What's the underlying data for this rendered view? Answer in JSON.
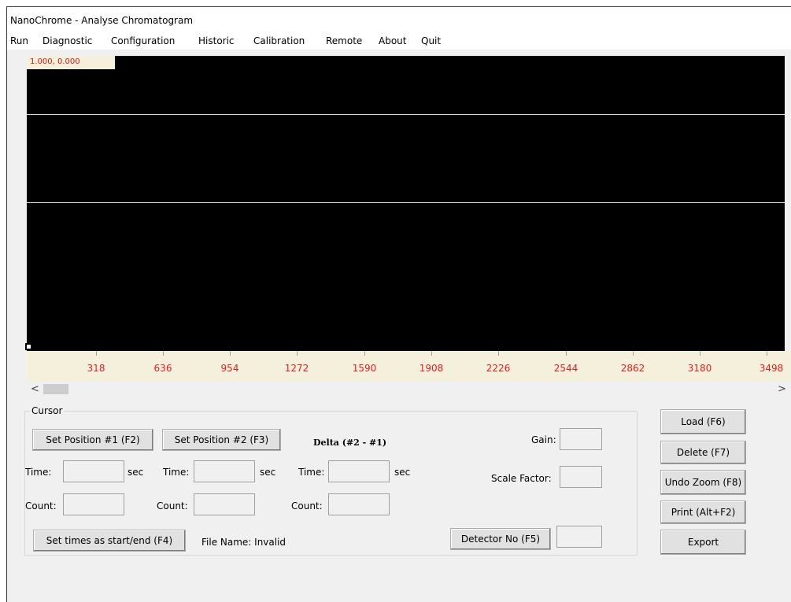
{
  "window": {
    "title": "NanoChrome - Analyse Chromatogram"
  },
  "menu": [
    "Run",
    "Diagnostic",
    "Configuration",
    "Historic",
    "Calibration",
    "Remote",
    "About",
    "Quit"
  ],
  "plot": {
    "coord_readout": "1.000, 0.000",
    "background": "#000000",
    "label_color": "#e02020"
  },
  "x_axis": {
    "ticks": [
      "318",
      "636",
      "954",
      "1272",
      "1590",
      "1908",
      "2226",
      "2544",
      "2862",
      "3180",
      "3498"
    ]
  },
  "scrollbar": {
    "left_arrow": "<",
    "right_arrow": ">"
  },
  "cursor_panel": {
    "title": "Cursor",
    "set_position_1": "Set Position #1 (F2)",
    "set_position_2": "Set Position #2 (F3)",
    "delta_title": "Delta (#2 - #1)",
    "time_label": "Time:",
    "sec_label": "sec",
    "count_label": "Count:",
    "pos1": {
      "time": "",
      "count": ""
    },
    "pos2": {
      "time": "",
      "count": ""
    },
    "delta": {
      "time": "",
      "count": ""
    },
    "gain_label": "Gain:",
    "gain_value": "",
    "scale_factor_label": "Scale Factor:",
    "scale_factor_value": "",
    "set_times_button": "Set times as start/end (F4)",
    "file_name_label": "File Name: Invalid",
    "detector_button": "Detector No (F5)",
    "detector_value": ""
  },
  "side_buttons": {
    "load": "Load (F6)",
    "delete": "Delete (F7)",
    "undo_zoom": "Undo Zoom (F8)",
    "print": "Print (Alt+F2)",
    "export": "Export"
  }
}
